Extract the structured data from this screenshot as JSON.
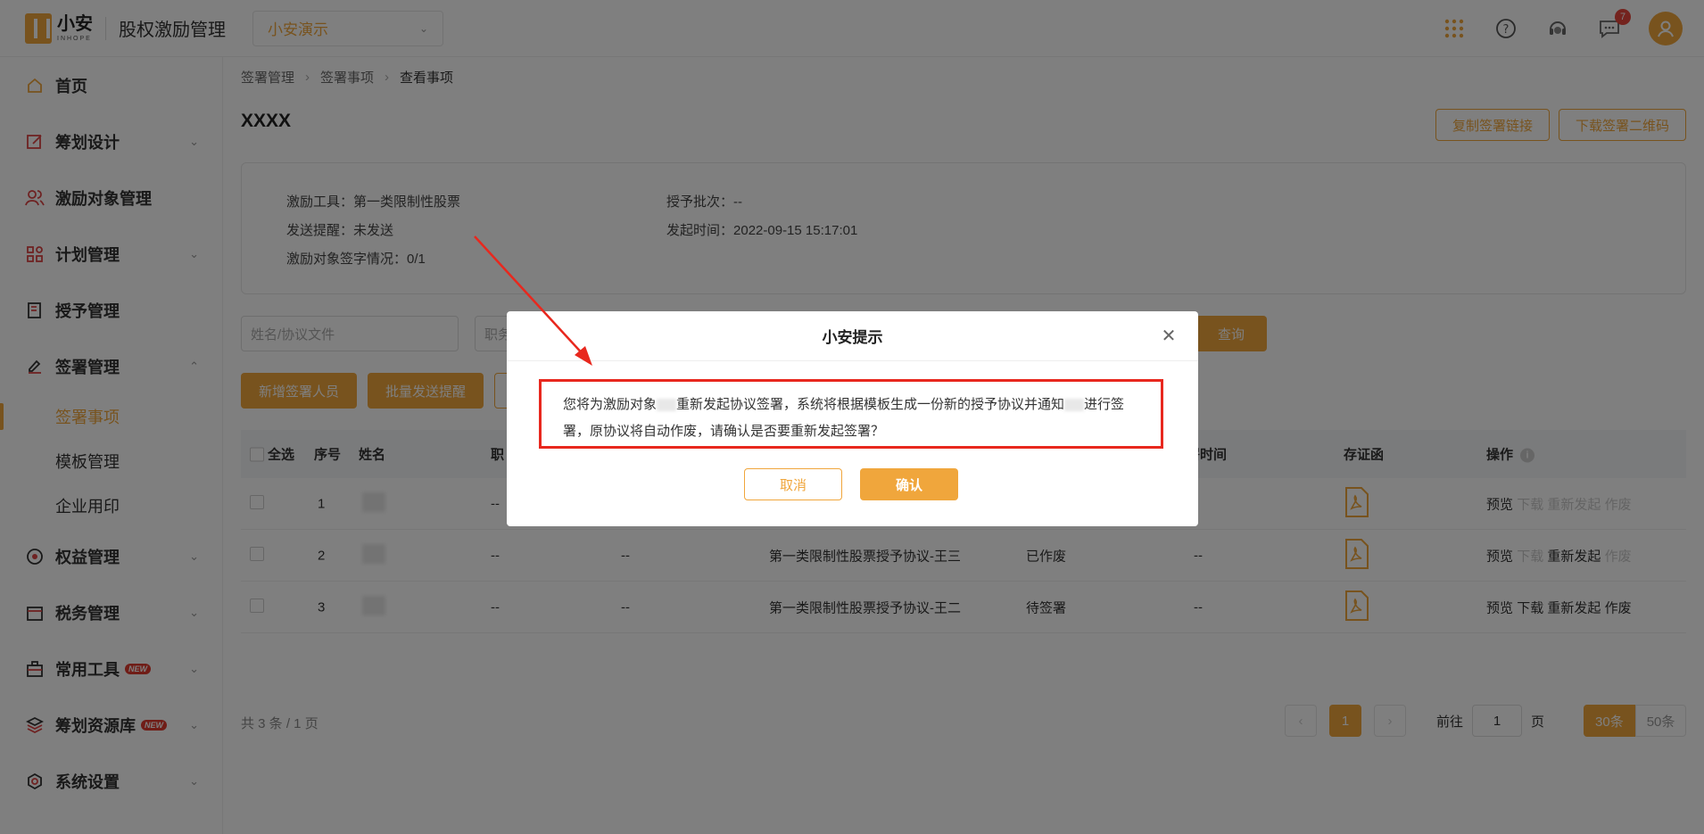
{
  "header": {
    "logo_cn": "小安",
    "logo_en": "INHOPE",
    "app_title": "股权激励管理",
    "org_select": "小安演示",
    "message_badge": "7"
  },
  "sidebar": {
    "items": [
      {
        "label": "首页",
        "icon": "home-icon"
      },
      {
        "label": "筹划设计",
        "icon": "edit-icon"
      },
      {
        "label": "激励对象管理",
        "icon": "users-icon"
      },
      {
        "label": "计划管理",
        "icon": "grid-icon"
      },
      {
        "label": "授予管理",
        "icon": "book-icon"
      },
      {
        "label": "签署管理",
        "icon": "sign-icon"
      },
      {
        "label": "权益管理",
        "icon": "medal-icon"
      },
      {
        "label": "税务管理",
        "icon": "tax-icon"
      },
      {
        "label": "常用工具",
        "icon": "toolbox-icon",
        "tag": "NEW"
      },
      {
        "label": "筹划资源库",
        "icon": "layers-icon",
        "tag": "NEW"
      },
      {
        "label": "系统设置",
        "icon": "settings-icon"
      }
    ],
    "sub_items": [
      "签署事项",
      "模板管理",
      "企业用印"
    ]
  },
  "breadcrumb": [
    "签署管理",
    "签署事项",
    "查看事项"
  ],
  "page": {
    "title": "XXXX",
    "copy_link_btn": "复制签署链接",
    "download_qr_btn": "下载签署二维码"
  },
  "info": {
    "tool_label": "激励工具：",
    "tool_value": "第一类限制性股票",
    "batch_label": "授予批次：",
    "batch_value": "--",
    "remind_label": "发送提醒：",
    "remind_value": "未发送",
    "time_label": "发起时间：",
    "time_value": "2022-09-15 15:17:01",
    "sign_label": "激励对象签字情况：",
    "sign_value": "0/1"
  },
  "filters": {
    "name_placeholder": "姓名/协议文件",
    "position_placeholder": "职务",
    "query_btn": "查询"
  },
  "actions": {
    "add_btn": "新增签署人员",
    "batch_btn": "批量发送提醒"
  },
  "table": {
    "headers": {
      "select_all": "全选",
      "index": "序号",
      "name": "姓名",
      "position": "职",
      "time": "署时间",
      "evidence": "存证函",
      "ops": "操作"
    },
    "rows": [
      {
        "index": "1",
        "c1": "--",
        "c2": "",
        "agreement": "",
        "status": "",
        "time": "",
        "op_preview": "预览",
        "op_download": "下载",
        "op_restart": "重新发起",
        "op_void": "作废"
      },
      {
        "index": "2",
        "c1": "--",
        "c2": "--",
        "agreement": "第一类限制性股票授予协议-王三",
        "status": "已作废",
        "time": "--",
        "op_preview": "预览",
        "op_download": "下载",
        "op_restart": "重新发起",
        "op_void": "作废"
      },
      {
        "index": "3",
        "c1": "--",
        "c2": "--",
        "agreement": "第一类限制性股票授予协议-王二",
        "status": "待签署",
        "time": "--",
        "op_preview": "预览",
        "op_download": "下载",
        "op_restart": "重新发起",
        "op_void": "作废"
      }
    ]
  },
  "pagination": {
    "total": "共 3 条 / 1 页",
    "current_page": "1",
    "goto_label": "前往",
    "goto_value": "1",
    "page_unit": "页",
    "size_30": "30条",
    "size_50": "50条"
  },
  "dialog": {
    "title": "小安提示",
    "msg_part1": "您将为激励对象",
    "msg_part2": "重新发起协议签署，系统将根据模板生成一份新的授予协议并通知",
    "msg_part3": "进行签署，原协议将自动作废，请确认是否要重新发起签署？",
    "cancel": "取消",
    "confirm": "确认"
  },
  "colors": {
    "accent": "#f0a63c",
    "highlight_border": "#e8281e",
    "badge": "#e8473c"
  }
}
